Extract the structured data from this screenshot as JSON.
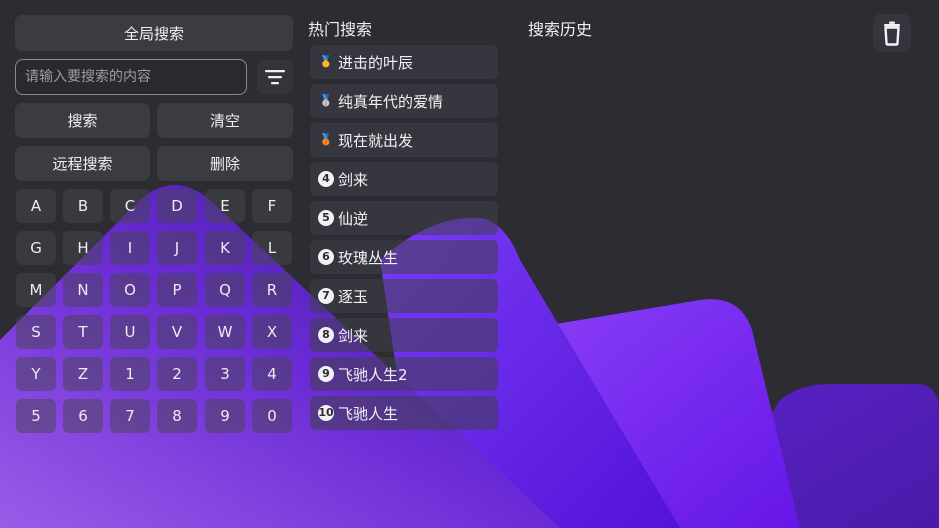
{
  "left_panel": {
    "global_search_label": "全局搜索",
    "search_placeholder": "请输入要搜索的内容",
    "search_label": "搜索",
    "clear_label": "清空",
    "remote_search_label": "远程搜索",
    "delete_label": "删除",
    "filter_icon": "filter-icon",
    "keys": [
      "A",
      "B",
      "C",
      "D",
      "E",
      "F",
      "G",
      "H",
      "I",
      "J",
      "K",
      "L",
      "M",
      "N",
      "O",
      "P",
      "Q",
      "R",
      "S",
      "T",
      "U",
      "V",
      "W",
      "X",
      "Y",
      "Z",
      "1",
      "2",
      "3",
      "4",
      "5",
      "6",
      "7",
      "8",
      "9",
      "0"
    ]
  },
  "hot": {
    "title": "热门搜索",
    "items": [
      {
        "rank": "🥇",
        "label": "进击的叶辰"
      },
      {
        "rank": "🥈",
        "label": "纯真年代的爱情"
      },
      {
        "rank": "🥉",
        "label": "现在就出发"
      },
      {
        "rank": "4",
        "label": "剑来"
      },
      {
        "rank": "5",
        "label": "仙逆"
      },
      {
        "rank": "6",
        "label": "玫瑰丛生"
      },
      {
        "rank": "7",
        "label": "逐玉"
      },
      {
        "rank": "8",
        "label": "剑来"
      },
      {
        "rank": "9",
        "label": "飞驰人生2"
      },
      {
        "rank": "10",
        "label": "飞驰人生"
      }
    ]
  },
  "history": {
    "title": "搜索历史",
    "delete_icon": "trash-icon"
  },
  "colors": {
    "background": "#2c2c32",
    "accent_purple": "#6a2cf0",
    "accent_violet": "#5a1fd0"
  }
}
